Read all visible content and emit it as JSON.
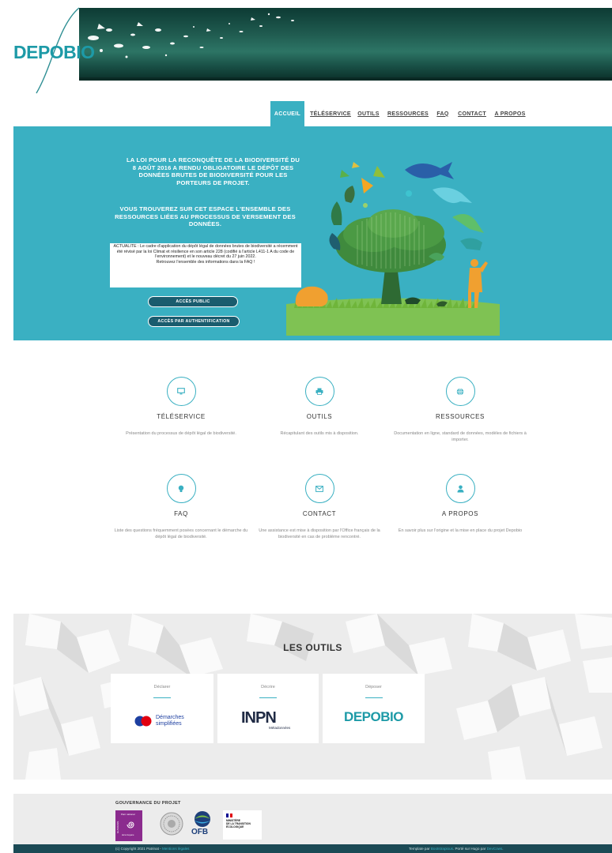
{
  "logo": {
    "text": "DEPOBIO"
  },
  "nav": [
    {
      "label": "ACCUEIL",
      "active": true
    },
    {
      "label": "TÉLÉSERVICE",
      "active": false
    },
    {
      "label": "OUTILS",
      "active": false
    },
    {
      "label": "RESSOURCES",
      "active": false
    },
    {
      "label": "FAQ",
      "active": false
    },
    {
      "label": "CONTACT",
      "active": false
    },
    {
      "label": "A PROPOS",
      "active": false
    }
  ],
  "hero": {
    "title": "LA LOI POUR LA RECONQUÊTE DE LA BIODIVERSITÉ DU 8 AOÛT 2016 A RENDU OBLIGATOIRE LE DÉPÔT DES DONNÉES BRUTES DE BIODIVERSITÉ POUR LES PORTEURS DE PROJET.",
    "subtitle": "VOUS TROUVEREZ SUR CET ESPACE L'ENSEMBLE DES RESSOURCES LIÉES AU PROCESSUS DE VERSEMENT DES DONNÉES.",
    "notice": "ACTUALITE : Le cadre d'application du dépôt légal de données brutes de biodiversité a récemment été révisé par la loi Climat et résilience en son article 228 (codifié à l'article L411-1 A du code de l'environnement) et le nouveau décret du 27 juin 2022.",
    "notice_link": "Retrouvez l'ensemble des informations dans la FAQ !",
    "btn_public": "ACCÈS PUBLIC",
    "btn_auth": "ACCÈS PAR AUTHENTIFICATION"
  },
  "services": [
    {
      "icon": "monitor-icon",
      "title": "TÉLÉSERVICE",
      "desc": "Présentation du processus de dépôt légal de biodiversité."
    },
    {
      "icon": "printer-icon",
      "title": "OUTILS",
      "desc": "Récapitulant des outils mis à disposition."
    },
    {
      "icon": "globe-icon",
      "title": "RESSOURCES",
      "desc": "Documentation en ligne, standard de données, modèles de fichiers à importer."
    },
    {
      "icon": "lightbulb-icon",
      "title": "FAQ",
      "desc": "Liste des questions fréquemment posées concernant le démarche du dépôt légal de biodiversité."
    },
    {
      "icon": "envelope-icon",
      "title": "CONTACT",
      "desc": "Une assistance est mise à disposition par l'Office français de la biodiversité en cas de problème rencontré."
    },
    {
      "icon": "user-icon",
      "title": "A PROPOS",
      "desc": "En savoir plus sur l'origine et la mise en place du projet Depobio"
    }
  ],
  "tools": {
    "title": "LES OUTILS",
    "cards": [
      {
        "label": "Déclarer",
        "logo_line1": "Démarches",
        "logo_line2": "simplifiées"
      },
      {
        "label": "Décrire",
        "logo_text": "INPN",
        "logo_sub": "Métadonnées"
      },
      {
        "label": "Déposer",
        "logo_text": "DEPOBIO"
      }
    ]
  },
  "governance": {
    "title": "GOUVERNANCE DU PROJET",
    "pn_vertical": "GUYANAIS",
    "pn_text": "Parc national",
    "pn_sub": "de la Guyane",
    "ofb": "OFB",
    "ministry_lines": [
      "MINISTÈRE",
      "DE LA TRANSITION",
      "ÉCOLOGIQUE"
    ]
  },
  "footer": {
    "copyright": "(c) Copyright 2021 Patrinat - ",
    "copyright_link": "Mentions légales",
    "template_text": "Template par ",
    "template_link": "Bootstrapious",
    "ported_text": ". Porté sur Hugo par ",
    "ported_link": "DevCows",
    "end": "."
  },
  "colors": {
    "accent": "#3ab0c2",
    "footer": "#1b4a55",
    "banner": "#1f5a4f"
  }
}
